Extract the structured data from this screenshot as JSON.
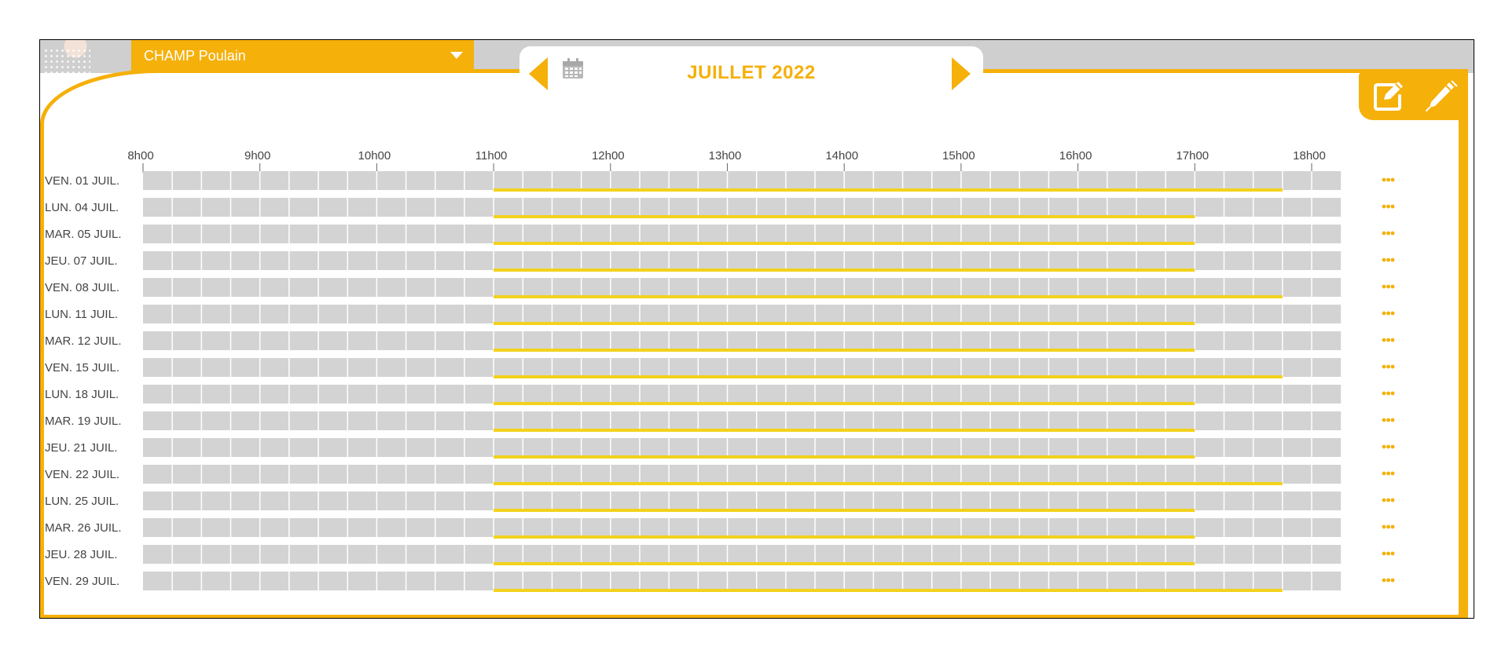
{
  "dropdown": {
    "value": "CHAMP Poulain"
  },
  "calendar": {
    "title": "JUILLET 2022"
  },
  "icons": {
    "prev": "chevron-left-icon",
    "calendar": "calendar-icon",
    "next": "chevron-right-icon",
    "edit": "edit-square-icon",
    "pen": "pen-icon",
    "more": "more-dots-icon"
  },
  "colors": {
    "accent": "#f5b00a",
    "slot_bar": "#f2d21c",
    "track": "#d3d3d3",
    "frame_gray": "#cfcfcf"
  },
  "chart_data": {
    "type": "gantt",
    "x_ticks": [
      "8h00",
      "9h00",
      "10h00",
      "11h00",
      "12h00",
      "13h00",
      "14h00",
      "15h00",
      "16h00",
      "17h00",
      "18h00"
    ],
    "x_range_hours": [
      8,
      18.25
    ],
    "slot_minutes": 15,
    "rows": [
      {
        "label": "VEN. 01 JUIL.",
        "start": "11h00",
        "end": "17h45"
      },
      {
        "label": "LUN. 04 JUIL.",
        "start": "11h00",
        "end": "17h00"
      },
      {
        "label": "MAR. 05 JUIL.",
        "start": "11h00",
        "end": "17h00"
      },
      {
        "label": "JEU. 07 JUIL.",
        "start": "11h00",
        "end": "17h00"
      },
      {
        "label": "VEN. 08 JUIL.",
        "start": "11h00",
        "end": "17h45"
      },
      {
        "label": "LUN. 11 JUIL.",
        "start": "11h00",
        "end": "17h00"
      },
      {
        "label": "MAR. 12 JUIL.",
        "start": "11h00",
        "end": "17h00"
      },
      {
        "label": "VEN. 15 JUIL.",
        "start": "11h00",
        "end": "17h45"
      },
      {
        "label": "LUN. 18 JUIL.",
        "start": "11h00",
        "end": "17h00"
      },
      {
        "label": "MAR. 19 JUIL.",
        "start": "11h00",
        "end": "17h00"
      },
      {
        "label": "JEU. 21 JUIL.",
        "start": "11h00",
        "end": "17h00"
      },
      {
        "label": "VEN. 22 JUIL.",
        "start": "11h00",
        "end": "17h45"
      },
      {
        "label": "LUN. 25 JUIL.",
        "start": "11h00",
        "end": "17h00"
      },
      {
        "label": "MAR. 26 JUIL.",
        "start": "11h00",
        "end": "17h00"
      },
      {
        "label": "JEU. 28 JUIL.",
        "start": "11h00",
        "end": "17h00"
      },
      {
        "label": "VEN. 29 JUIL.",
        "start": "11h00",
        "end": "17h45"
      }
    ]
  }
}
